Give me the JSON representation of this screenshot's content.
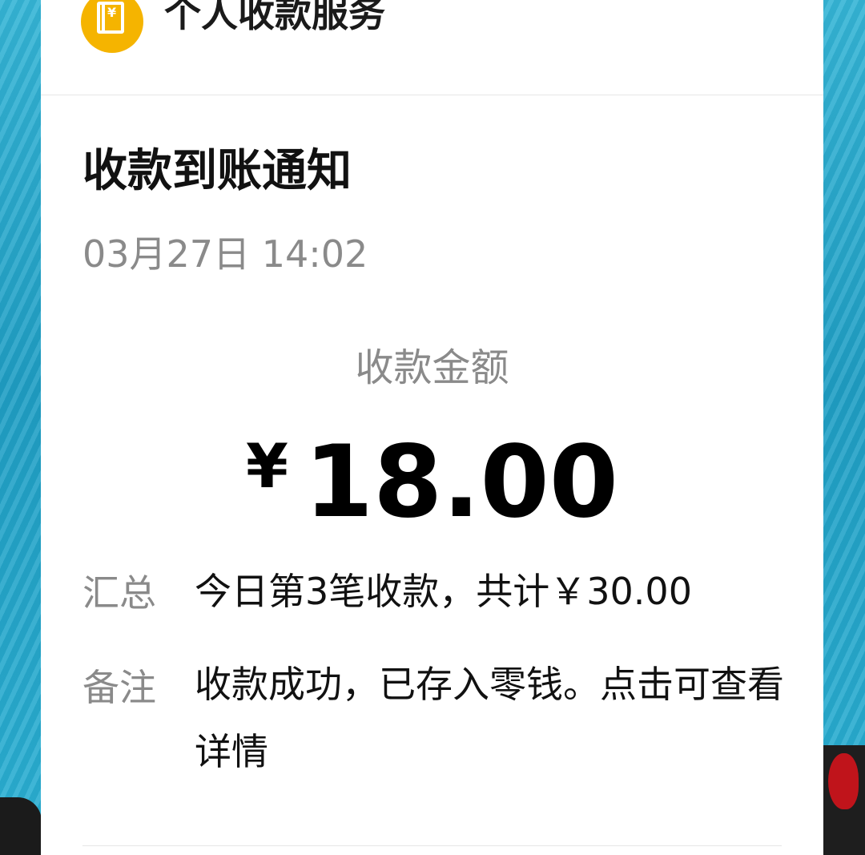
{
  "header": {
    "app_icon": "yen-wallet-icon",
    "service_name": "个人收款服务"
  },
  "notification": {
    "title": "收款到账通知",
    "datetime": "03月27日 14:02",
    "amount_label": "收款金额",
    "currency_symbol": "¥",
    "amount": "18.00",
    "summary_label": "汇总",
    "summary_text": "今日第3笔收款，共计￥30.00",
    "remark_label": "备注",
    "remark_text": "收款成功，已存入零钱。点击可查看详情"
  },
  "colors": {
    "icon_bg": "#f5b400",
    "background": "#2aa6c9",
    "card": "#ffffff",
    "text_primary": "#111111",
    "text_secondary": "#8a8a8a"
  }
}
